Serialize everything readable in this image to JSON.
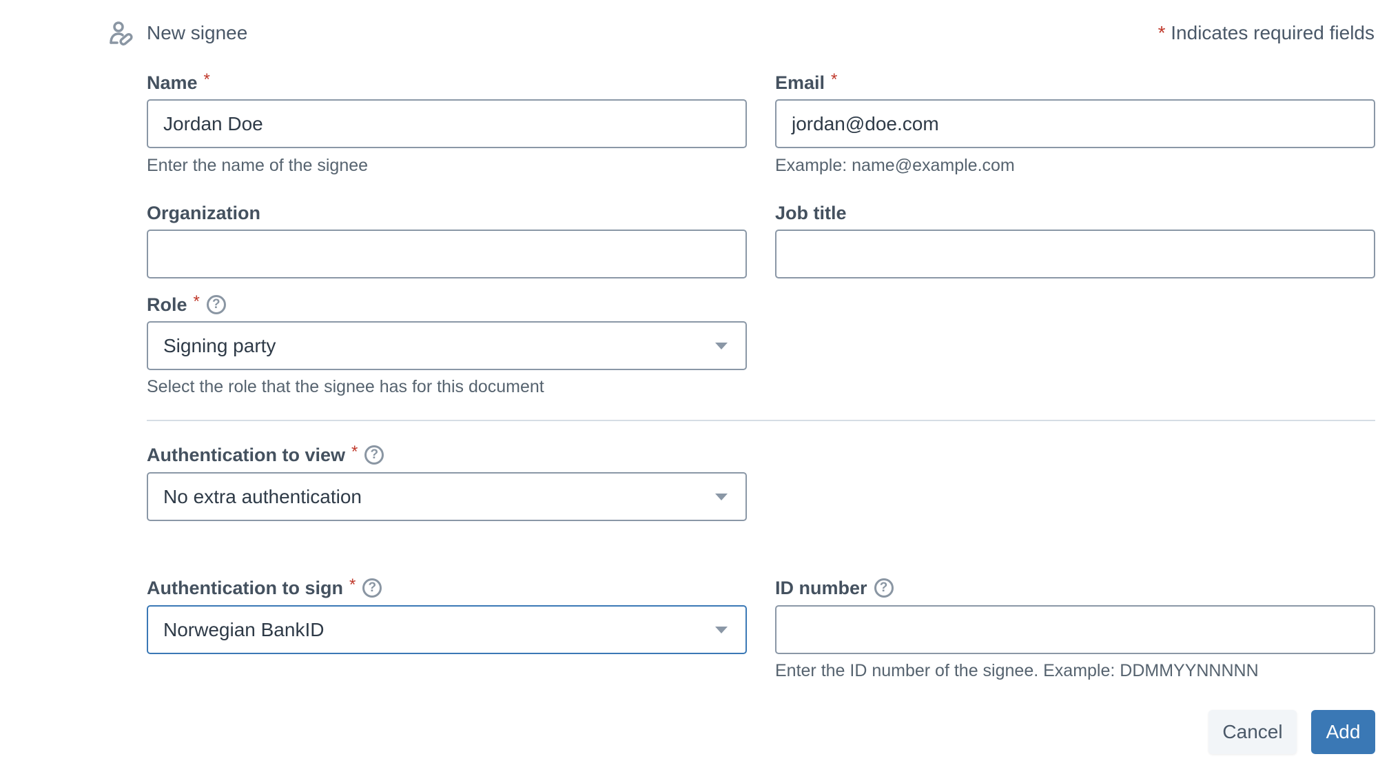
{
  "header": {
    "icon": "user-edit-icon",
    "title": "New signee",
    "required_star": "*",
    "required_note": "Indicates required fields"
  },
  "colors": {
    "accent": "#3a78b5",
    "required": "#c0392b",
    "border": "#8a97a6",
    "divider": "#d5dde5"
  },
  "fields": {
    "name": {
      "label": "Name",
      "required": "*",
      "value": "Jordan Doe",
      "helper": "Enter the name of the signee"
    },
    "email": {
      "label": "Email",
      "required": "*",
      "value": "jordan@doe.com",
      "helper": "Example: name@example.com"
    },
    "organization": {
      "label": "Organization",
      "value": ""
    },
    "job_title": {
      "label": "Job title",
      "value": ""
    },
    "role": {
      "label": "Role",
      "required": "*",
      "help_icon": "?",
      "selected": "Signing party",
      "helper": "Select the role that the signee has for this document"
    },
    "auth_view": {
      "label": "Authentication to view",
      "required": "*",
      "help_icon": "?",
      "selected": "No extra authentication"
    },
    "auth_sign": {
      "label": "Authentication to sign",
      "required": "*",
      "help_icon": "?",
      "selected": "Norwegian BankID"
    },
    "id_number": {
      "label": "ID number",
      "help_icon": "?",
      "value": "",
      "helper": "Enter the ID number of the signee. Example: DDMMYYNNNNN"
    }
  },
  "buttons": {
    "cancel": "Cancel",
    "add": "Add"
  }
}
